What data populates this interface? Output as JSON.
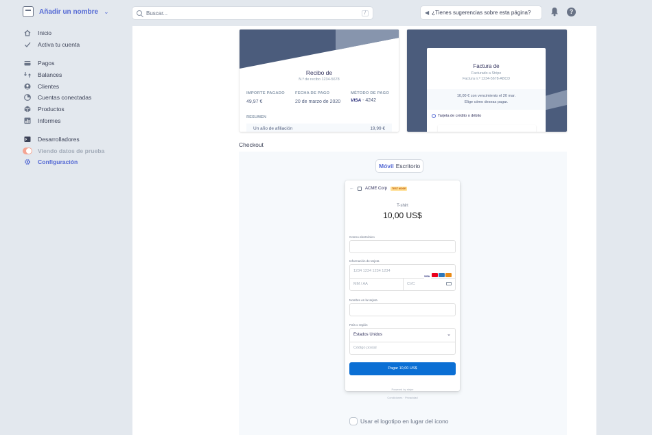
{
  "topbar": {
    "account_name": "Añadir un nombre",
    "search_placeholder": "Buscar...",
    "search_shortcut": "/",
    "suggest_label": "¿Tienes sugerencias sobre esta página?",
    "help_label": "?"
  },
  "sidebar": {
    "groups": [
      [
        {
          "label": "Inicio",
          "icon": "home-icon"
        },
        {
          "label": "Activa tu cuenta",
          "icon": "check-icon"
        }
      ],
      [
        {
          "label": "Pagos",
          "icon": "payments-icon"
        },
        {
          "label": "Balances",
          "icon": "balances-icon"
        },
        {
          "label": "Clientes",
          "icon": "customers-icon"
        },
        {
          "label": "Cuentas conectadas",
          "icon": "connect-icon"
        },
        {
          "label": "Productos",
          "icon": "products-icon"
        },
        {
          "label": "Informes",
          "icon": "reports-icon"
        }
      ],
      [
        {
          "label": "Desarrolladores",
          "icon": "terminal-icon"
        },
        {
          "label": "Viendo datos de prueba",
          "icon": "toggle"
        },
        {
          "label": "Configuración",
          "icon": "gear-icon"
        }
      ]
    ]
  },
  "receipt": {
    "title": "Recibo de",
    "number": "N.º de recibo 1234-5678",
    "cols": [
      {
        "header": "IMPORTE PAGADO",
        "value": "49,97 €"
      },
      {
        "header": "FECHA DE PAGO",
        "value": "20 de marzo de 2020"
      },
      {
        "header": "MÉTODO DE PAGO",
        "brand": "VISA",
        "value": " - 4242"
      }
    ],
    "summary_header": "RESUMEN",
    "summary_item": "Un año de afiliación",
    "summary_amount": "19,99 €"
  },
  "invoice": {
    "title": "Factura de",
    "billed_to": "Facturado a Stripe",
    "number": "Factura n.º 1234-5678-ABCD",
    "due_line1": "10,00 € con vencimiento el 20 mar.",
    "due_line2": "Elige cómo deseas pagar.",
    "method": "Tarjeta de crédito o débito"
  },
  "checkout": {
    "section_title": "Checkout",
    "tab_mobile": "Móvil",
    "tab_desktop": "Escritorio",
    "merchant": "ACME Corp",
    "test_badge": "TEST MODE",
    "product": "T-shirt",
    "price": "10,00 US$",
    "email_label": "Correo electrónico",
    "card_label": "Información de tarjeta",
    "card_number_placeholder": "1234 1234 1234 1234",
    "expiry_placeholder": "MM / AA",
    "cvc_placeholder": "CVC",
    "card_name_label": "Nombre en la tarjeta",
    "country_label": "País o región",
    "country_value": "Estados Unidos",
    "postal_placeholder": "Código postal",
    "pay_button": "Pagar 10,00 US$",
    "powered_by": "Powered by stripe",
    "terms": "Condiciones",
    "privacy": "Privacidad",
    "logo_option": "Usar el logotipo en lugar del icono"
  },
  "colors": {
    "accent": "#5469d4",
    "banner": "#4b5c7c",
    "pay_button": "#0b6fd4",
    "toggle": "#f5a492"
  }
}
